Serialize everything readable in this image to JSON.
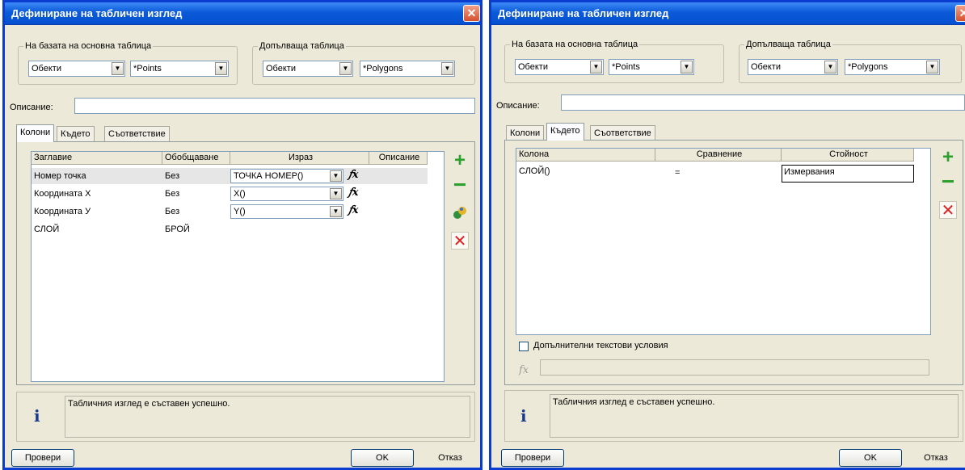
{
  "dialog_title": "Дефиниране на табличен изглед",
  "base_group_label": "На базата на основна таблица",
  "join_group_label": "Допълваща таблица",
  "base_type": "Обекти",
  "base_table": "*Points",
  "join_type": "Обекти",
  "join_table": "*Polygons",
  "description_label": "Описание:",
  "tabs": [
    "Колони",
    "Където",
    "Съответствие"
  ],
  "left": {
    "headers": [
      "Заглавие",
      "Обобщаване",
      "Израз",
      "Описание"
    ],
    "rows": [
      {
        "title": "Номер точка",
        "agg": "Без",
        "expr": "ТОЧКА НОМЕР()"
      },
      {
        "title": "Координата X",
        "agg": "Без",
        "expr": "X()"
      },
      {
        "title": "Координата У",
        "agg": "Без",
        "expr": "Y()"
      },
      {
        "title": "СЛОЙ",
        "agg": "БРОЙ",
        "expr": ""
      }
    ]
  },
  "right": {
    "headers": [
      "Колона",
      "Сравнение",
      "Стойност"
    ],
    "rows": [
      {
        "column": "СЛОЙ()",
        "op": "=",
        "value": "Измервания"
      }
    ],
    "extra_conditions_label": "Допълнителни текстови условия"
  },
  "info_icon": "i",
  "status_message": "Табличния изглед е съставен успешно.",
  "buttons": {
    "check": "Провери",
    "ok": "OK",
    "cancel": "Отказ"
  },
  "icons": {
    "close": "close-icon",
    "add": "plus-icon",
    "remove": "minus-icon",
    "edit": "edit-icon",
    "delete": "delete-icon",
    "function": "fx-icon",
    "info": "info-icon"
  },
  "colors": {
    "titlebar": "#0b5ad8",
    "dialog_bg": "#ece9d8",
    "close": "#d5502d",
    "add": "#2ca02c",
    "delete": "#e02020"
  }
}
